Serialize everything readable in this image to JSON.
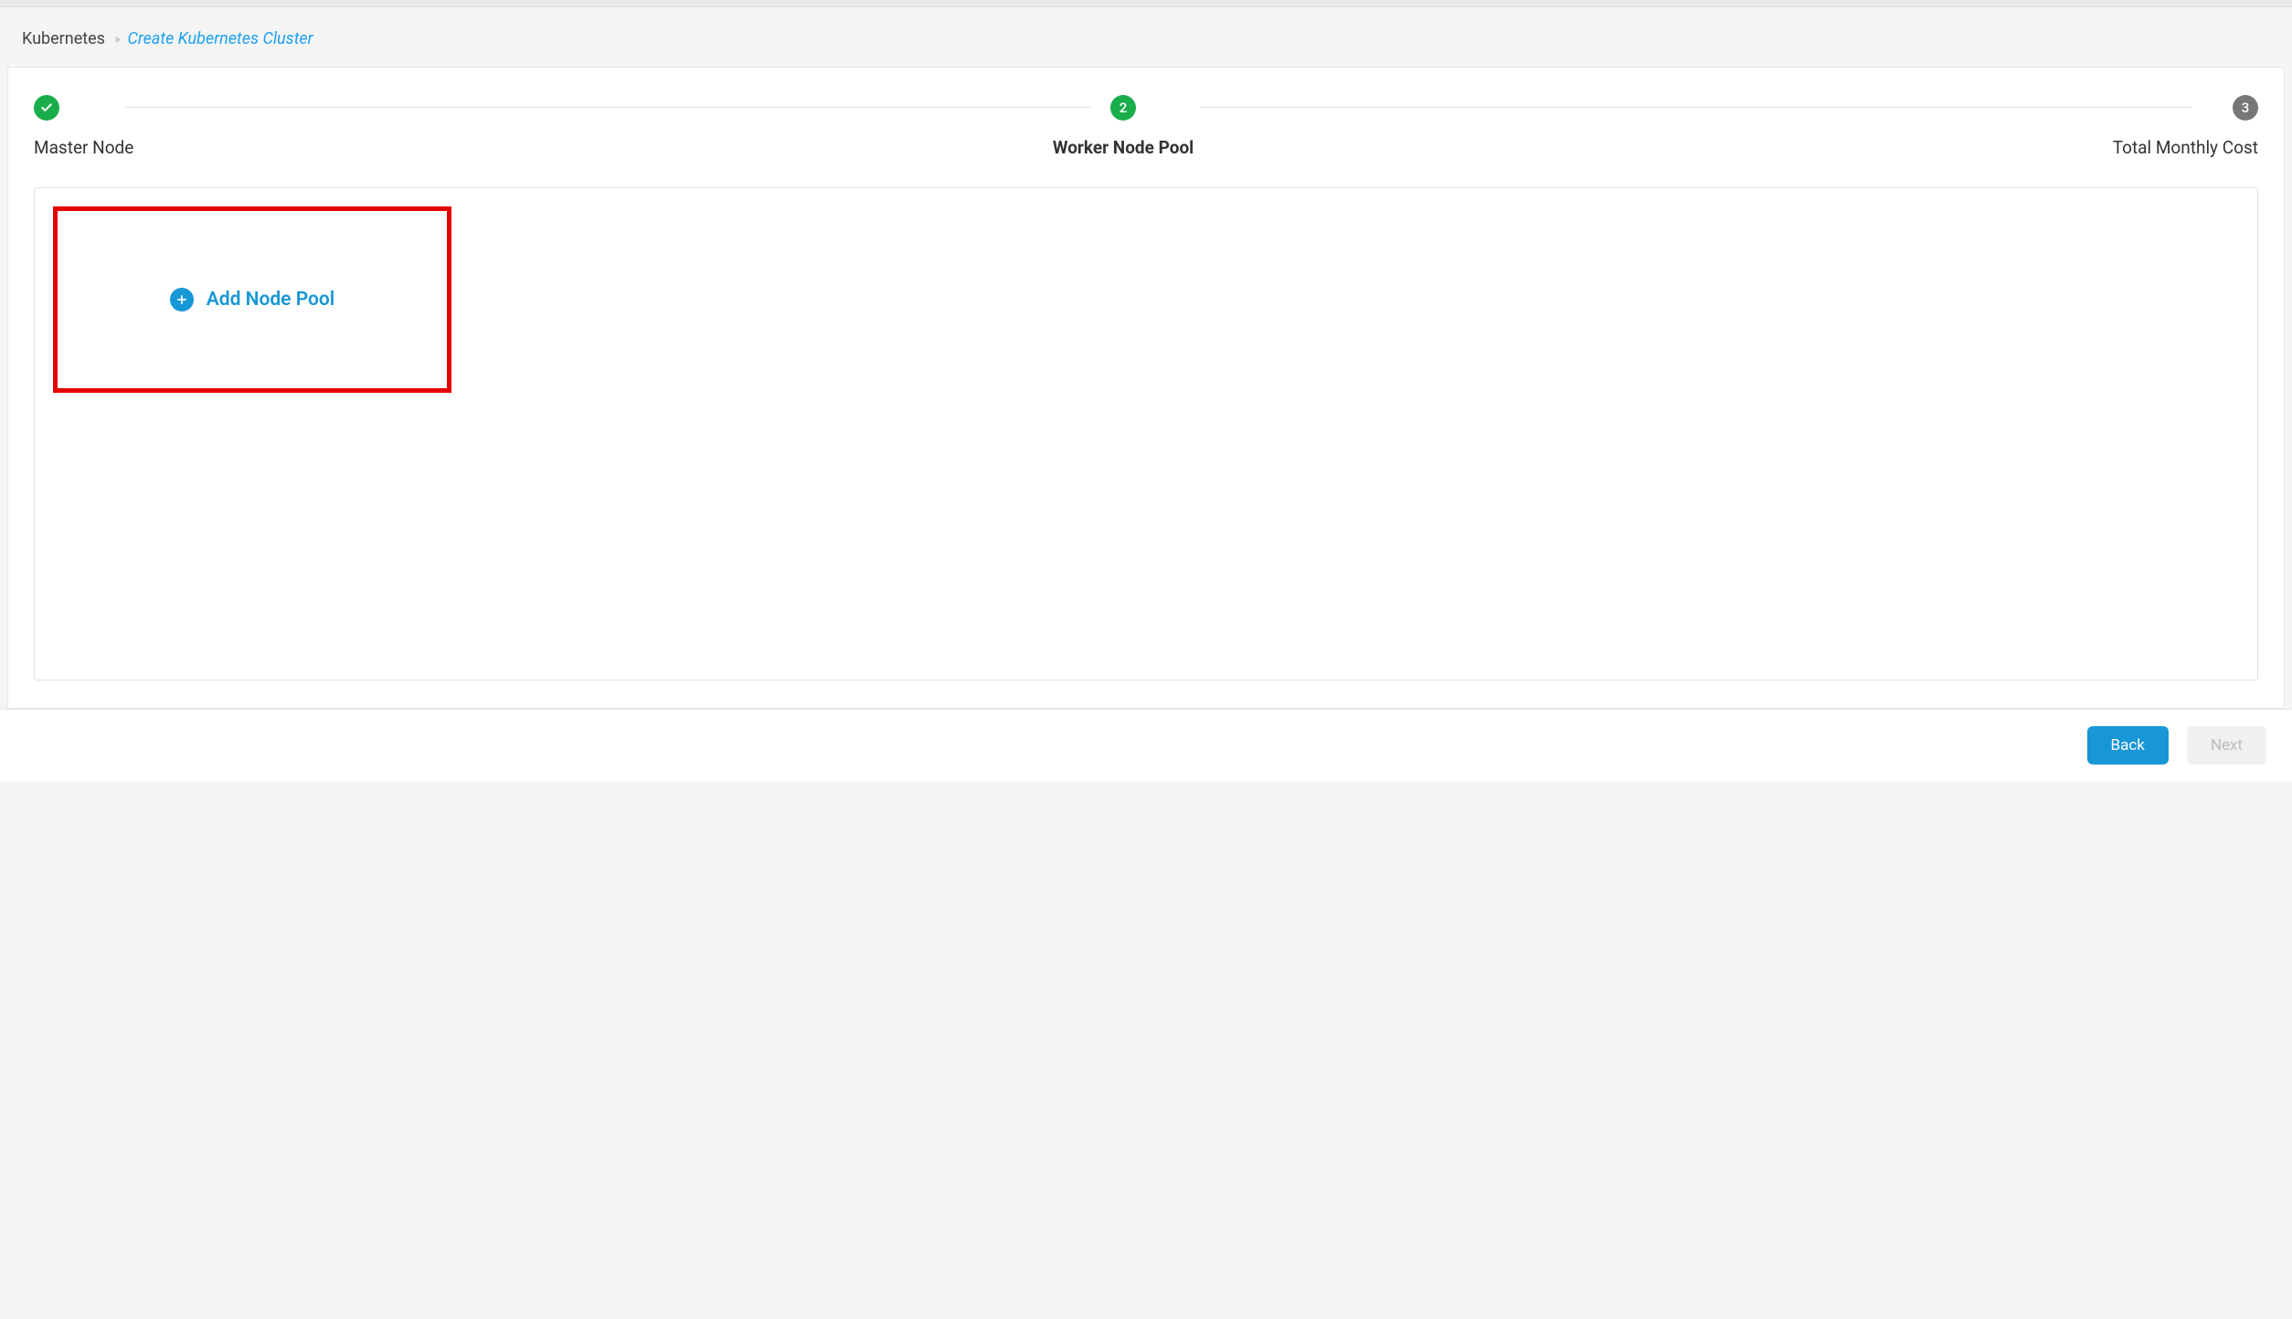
{
  "breadcrumb": {
    "root": "Kubernetes",
    "separator": "»",
    "current": "Create Kubernetes Cluster"
  },
  "stepper": {
    "steps": [
      {
        "label": "Master Node",
        "state": "done"
      },
      {
        "label": "Worker Node Pool",
        "state": "active",
        "number": "2"
      },
      {
        "label": "Total Monthly Cost",
        "state": "pending",
        "number": "3"
      }
    ]
  },
  "content": {
    "add_node_pool_label": "Add Node Pool"
  },
  "footer": {
    "back_label": "Back",
    "next_label": "Next"
  }
}
